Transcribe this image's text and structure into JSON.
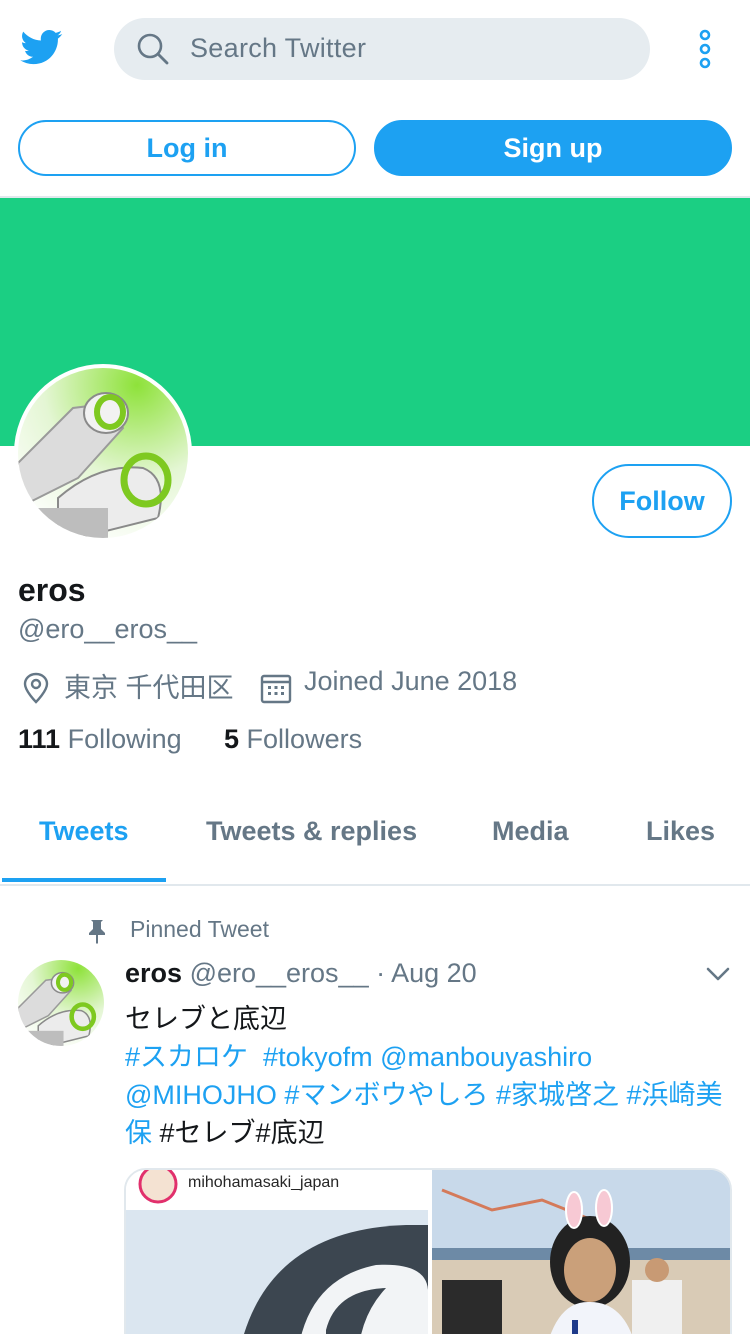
{
  "header": {
    "logo_icon": "twitter-bird-icon",
    "search": {
      "placeholder": "Search Twitter",
      "icon": "search-icon"
    },
    "more_icon": "more-vertical-icon"
  },
  "auth": {
    "login_label": "Log in",
    "signup_label": "Sign up"
  },
  "colors": {
    "accent": "#1da1f2",
    "banner": "#1bcf83",
    "muted": "#657786"
  },
  "profile": {
    "follow_label": "Follow",
    "display_name": "eros",
    "handle": "@ero__eros__",
    "location": "東京 千代田区",
    "joined": "Joined June 2018",
    "following_count": "111",
    "following_label": "Following",
    "followers_count": "5",
    "followers_label": "Followers"
  },
  "tabs": [
    {
      "label": "Tweets",
      "active": true
    },
    {
      "label": "Tweets & replies",
      "active": false
    },
    {
      "label": "Media",
      "active": false
    },
    {
      "label": "Likes",
      "active": false
    }
  ],
  "pinned_tweet": {
    "pinned_label": "Pinned Tweet",
    "author_name": "eros",
    "author_handle": "@ero__eros__",
    "separator": "·",
    "date": "Aug 20",
    "text_line": "セレブと底辺",
    "tags": [
      "#スカロケ",
      "#tokyofm",
      "@manbouyashiro",
      "@MIHOJHO",
      "#マンボウやしろ",
      "#家城啓之",
      "#浜崎美保",
      "#セレブ",
      "#底辺"
    ],
    "media_caption": "mihohamasaki_japan"
  }
}
